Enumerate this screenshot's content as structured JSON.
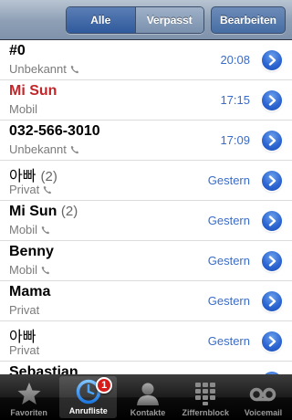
{
  "navbar": {
    "segments": [
      {
        "label": "Alle",
        "selected": true
      },
      {
        "label": "Verpasst",
        "selected": false
      }
    ],
    "edit_label": "Bearbeiten"
  },
  "calls": [
    {
      "name": "#0",
      "count": "",
      "type": "Unbekannt",
      "has_phone_icon": true,
      "time": "20:08",
      "missed": false,
      "script": "latin"
    },
    {
      "name": "Mi Sun",
      "count": "",
      "type": "Mobil",
      "has_phone_icon": false,
      "time": "17:15",
      "missed": true,
      "script": "latin"
    },
    {
      "name": "032-566-3010",
      "count": "",
      "type": "Unbekannt",
      "has_phone_icon": true,
      "time": "17:09",
      "missed": false,
      "script": "latin"
    },
    {
      "name": "아빠",
      "count": "(2)",
      "type": "Privat",
      "has_phone_icon": true,
      "time": "Gestern",
      "missed": false,
      "script": "korean"
    },
    {
      "name": "Mi Sun",
      "count": "(2)",
      "type": "Mobil",
      "has_phone_icon": true,
      "time": "Gestern",
      "missed": false,
      "script": "latin"
    },
    {
      "name": "Benny",
      "count": "",
      "type": "Mobil",
      "has_phone_icon": true,
      "time": "Gestern",
      "missed": false,
      "script": "latin"
    },
    {
      "name": "Mama",
      "count": "",
      "type": "Privat",
      "has_phone_icon": false,
      "time": "Gestern",
      "missed": false,
      "script": "latin"
    },
    {
      "name": "아빠",
      "count": "",
      "type": "Privat",
      "has_phone_icon": false,
      "time": "Gestern",
      "missed": false,
      "script": "korean"
    },
    {
      "name": "Sebastian",
      "count": "",
      "type": "",
      "has_phone_icon": false,
      "time": "",
      "missed": false,
      "script": "latin"
    }
  ],
  "tabbar": {
    "tabs": [
      {
        "label": "Favoriten",
        "icon": "star-icon",
        "active": false
      },
      {
        "label": "Anrufliste",
        "icon": "clock-icon",
        "active": true
      },
      {
        "label": "Kontakte",
        "icon": "person-icon",
        "active": false
      },
      {
        "label": "Ziffernblock",
        "icon": "keypad-icon",
        "active": false
      },
      {
        "label": "Voicemail",
        "icon": "voicemail-icon",
        "active": false
      }
    ],
    "badge": "1"
  },
  "colors": {
    "missed": "#c0262a",
    "time": "#3a6cc9",
    "navbar": "#8d9fb5",
    "detail_button": "#2e66d2"
  }
}
